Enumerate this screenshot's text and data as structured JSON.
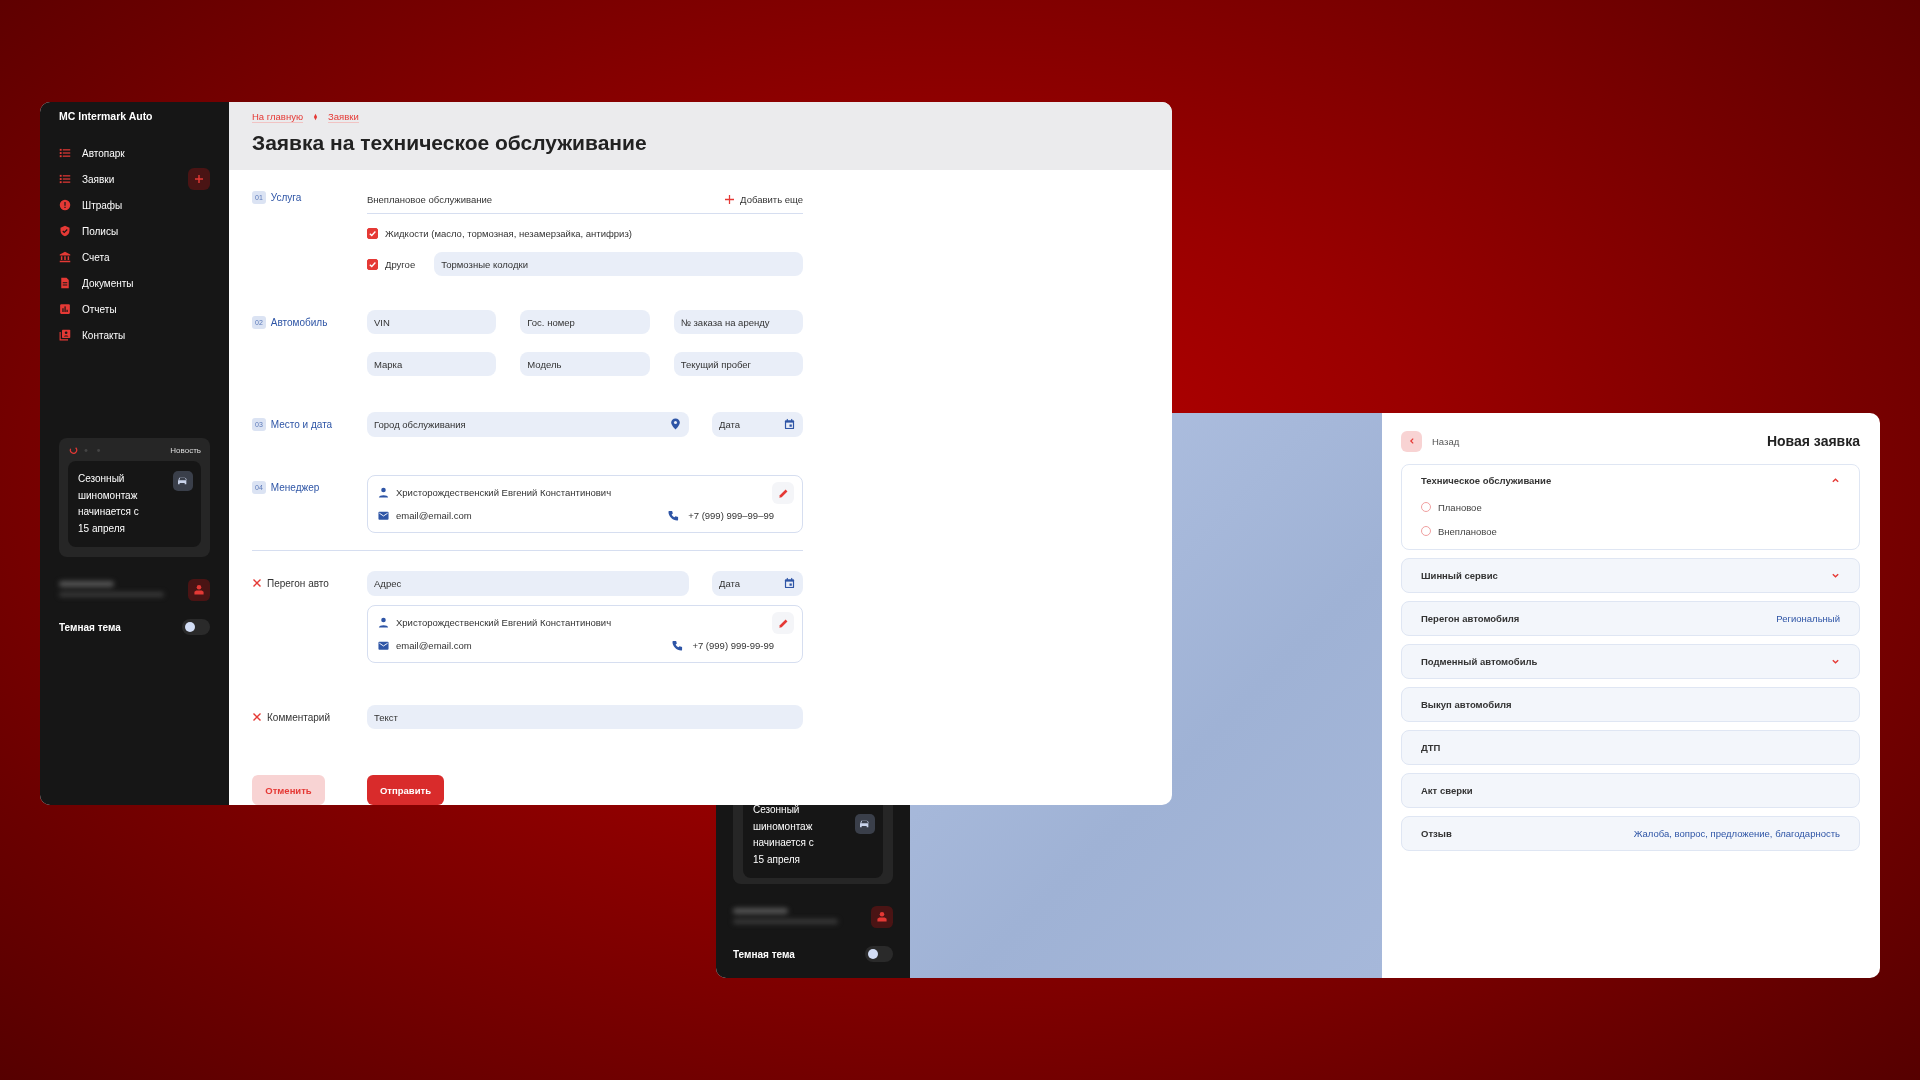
{
  "main_window": {
    "sidebar": {
      "brand": "MC Intermark Auto",
      "nav": [
        {
          "label": "Автопарк"
        },
        {
          "label": "Заявки",
          "add_button": true
        },
        {
          "label": "Штрафы"
        },
        {
          "label": "Полисы"
        },
        {
          "label": "Счета"
        },
        {
          "label": "Документы"
        },
        {
          "label": "Отчеты"
        },
        {
          "label": "Контакты"
        }
      ],
      "news": {
        "tag": "Новость",
        "text": "Сезонный шиномонтаж начинается с 15 апреля"
      },
      "theme_toggle": {
        "label": "Темная тема",
        "on": false
      }
    },
    "breadcrumbs": [
      "На главную",
      "Заявки"
    ],
    "title": "Заявка на техническое обслуживание",
    "form": {
      "service": {
        "number": "01",
        "label": "Услуга",
        "select": "Внеплановое обслуживание",
        "add_more": "Добавить еще",
        "options": [
          {
            "label": "Жидкости (масло, тормозная, незамерзайка, антифриз)",
            "checked": true
          },
          {
            "label": "Другое",
            "checked": true,
            "value": "Тормозные колодки"
          }
        ]
      },
      "car": {
        "number": "02",
        "label": "Автомобиль",
        "fields": [
          {
            "placeholder": "VIN"
          },
          {
            "placeholder": "Гос. номер"
          },
          {
            "placeholder": "№ заказа на аренду"
          },
          {
            "placeholder": "Марка"
          },
          {
            "placeholder": "Модель"
          },
          {
            "placeholder": "Текущий пробег"
          }
        ]
      },
      "place": {
        "number": "03",
        "label": "Место и дата",
        "city": {
          "placeholder": "Город обслуживания"
        },
        "date": {
          "placeholder": "Дата"
        }
      },
      "manager": {
        "number": "04",
        "label": "Менеджер",
        "contact": {
          "name": "Христорождественский Евгений Константинович",
          "email": "email@email.com",
          "phone": "+7 (999) 999–99–99"
        }
      },
      "transfer": {
        "label": "Перегон авто",
        "address": {
          "placeholder": "Адрес"
        },
        "date": {
          "placeholder": "Дата"
        },
        "contact": {
          "name": "Христорождественский Евгений Константинович",
          "email": "email@email.com",
          "phone": "+7 (999) 999-99-99"
        }
      },
      "comment": {
        "label": "Комментарий",
        "field": {
          "placeholder": "Текст"
        }
      },
      "buttons": {
        "cancel": "Отменить",
        "submit": "Отправить"
      }
    }
  },
  "back_window": {
    "sidebar": {
      "news": {
        "text": "Сезонный шиномонтаж начинается с 15 апреля"
      },
      "theme_toggle": {
        "label": "Темная тема",
        "on": false
      }
    },
    "panel": {
      "back": "Назад",
      "title": "Новая заявка",
      "options": [
        {
          "kind": "expandable",
          "label": "Техническое обслуживание",
          "expanded": true,
          "choices": [
            {
              "label": "Плановое",
              "selected": false
            },
            {
              "label": "Внеплановое",
              "selected": false
            }
          ]
        },
        {
          "kind": "expandable",
          "label": "Шинный сервис",
          "expanded": false
        },
        {
          "kind": "link",
          "label": "Перегон автомобиля",
          "value": "Региональный"
        },
        {
          "kind": "expandable",
          "label": "Подменный автомобиль",
          "expanded": false
        },
        {
          "kind": "plain",
          "label": "Выкуп автомобиля"
        },
        {
          "kind": "plain",
          "label": "ДТП"
        },
        {
          "kind": "plain",
          "label": "Акт сверки"
        },
        {
          "kind": "link",
          "label": "Отзыв",
          "value": "Жалоба, вопрос, предложение, благодарность"
        }
      ]
    }
  }
}
